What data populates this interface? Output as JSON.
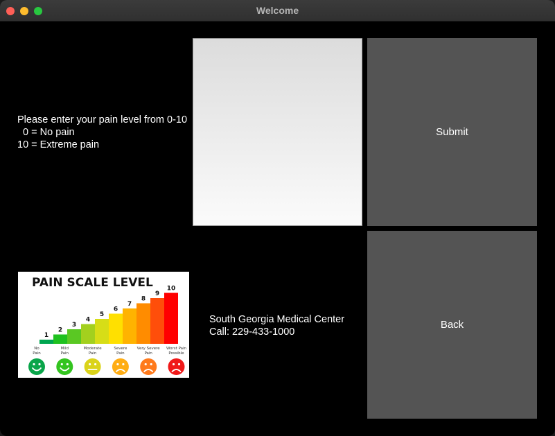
{
  "window": {
    "title": "Welcome"
  },
  "instructions": {
    "line1": "Please enter your pain level from 0-10",
    "line2": "  0 = No pain",
    "line3": "10 = Extreme pain"
  },
  "pain_input": {
    "value": ""
  },
  "buttons": {
    "submit": "Submit",
    "back": "Back"
  },
  "contact": {
    "name": "South Georgia Medical Center",
    "phone": "Call: 229-433-1000"
  },
  "pain_scale_image": {
    "title": "PAIN SCALE LEVEL",
    "levels": [
      "1",
      "2",
      "3",
      "4",
      "5",
      "6",
      "7",
      "8",
      "9",
      "10"
    ],
    "level_colors": [
      "#00a650",
      "#1fc11f",
      "#5ac823",
      "#a3d01e",
      "#d7dd17",
      "#ffe000",
      "#ffb300",
      "#ff8c00",
      "#ff4e0a",
      "#ff0000"
    ],
    "categories": [
      {
        "line1": "No",
        "line2": "Pain",
        "face": "happy",
        "color": "#0aa54a"
      },
      {
        "line1": "Mild",
        "line2": "Pain",
        "face": "happy",
        "color": "#33c41f"
      },
      {
        "line1": "Moderate",
        "line2": "Pain",
        "face": "neutral",
        "color": "#dbd31a"
      },
      {
        "line1": "Severe",
        "line2": "Pain",
        "face": "sad",
        "color": "#ffad14"
      },
      {
        "line1": "Very Severe",
        "line2": "Pain",
        "face": "sad",
        "color": "#ff7a1c"
      },
      {
        "line1": "Worst Pain",
        "line2": "Possible",
        "face": "crying",
        "color": "#f01919"
      }
    ]
  }
}
